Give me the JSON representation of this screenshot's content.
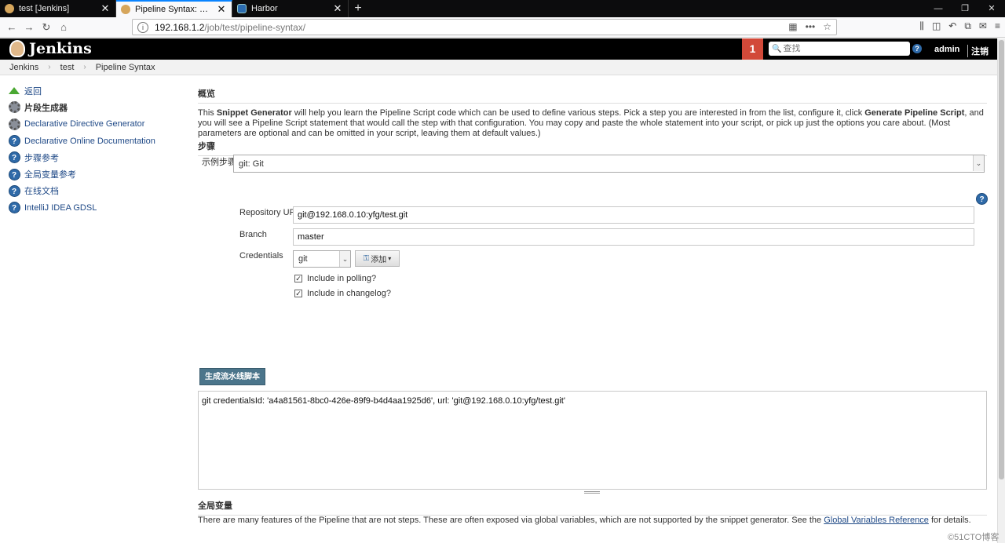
{
  "browser": {
    "tabs": [
      {
        "title": "test [Jenkins]",
        "active": false,
        "icon": "jenkins-favicon"
      },
      {
        "title": "Pipeline Syntax: Snippet Generator",
        "active": true,
        "icon": "jenkins-favicon"
      },
      {
        "title": "Harbor",
        "active": false,
        "icon": "harbor-favicon"
      }
    ],
    "url_host": "192.168.1.2",
    "url_path": "/job/test/pipeline-syntax/"
  },
  "header": {
    "logo_text": "Jenkins",
    "notification_count": "1",
    "search_placeholder": "查找",
    "user": "admin",
    "logout": "注销"
  },
  "breadcrumb": [
    "Jenkins",
    "test",
    "Pipeline Syntax"
  ],
  "sidebar": {
    "items": [
      {
        "label": "返回",
        "icon": "up-arrow-icon",
        "current": false
      },
      {
        "label": "片段生成器",
        "icon": "gear-icon",
        "current": true
      },
      {
        "label": "Declarative Directive Generator",
        "icon": "gear-icon",
        "current": false
      },
      {
        "label": "Declarative Online Documentation",
        "icon": "help-icon",
        "current": false
      },
      {
        "label": "步骤参考",
        "icon": "help-icon",
        "current": false
      },
      {
        "label": "全局变量参考",
        "icon": "help-icon",
        "current": false
      },
      {
        "label": "在线文档",
        "icon": "help-icon",
        "current": false
      },
      {
        "label": "IntelliJ IDEA GDSL",
        "icon": "help-icon",
        "current": false
      }
    ]
  },
  "main": {
    "overview_title": "概览",
    "intro_1": "This ",
    "intro_bold_1": "Snippet Generator",
    "intro_2": " will help you learn the Pipeline Script code which can be used to define various steps. Pick a step you are interested in from the list, configure it, click ",
    "intro_bold_2": "Generate Pipeline Script",
    "intro_3": ", and you will see a Pipeline Script statement that would call the step with that configuration. You may copy and paste the whole statement into your script, or pick up just the options you care about. (Most parameters are optional and can be omitted in your script, leaving them at default values.)",
    "steps_title": "步骤",
    "sample_step_label": "示例步骤",
    "sample_step_value": "git: Git",
    "repo_label": "Repository URL",
    "repo_value": "git@192.168.0.10:yfg/test.git",
    "branch_label": "Branch",
    "branch_value": "master",
    "credentials_label": "Credentials",
    "credentials_value": "git",
    "add_button": "添加",
    "polling_label": "Include in polling?",
    "polling_checked": true,
    "changelog_label": "Include in changelog?",
    "changelog_checked": true,
    "generate_button": "生成流水线脚本",
    "output": "git credentialsId: 'a4a81561-8bc0-426e-89f9-b4d4aa1925d6', url: 'git@192.168.0.10:yfg/test.git'",
    "global_title": "全局变量",
    "global_text_1": "There are many features of the Pipeline that are not steps. These are often exposed via global variables, which are not supported by the snippet generator. See the ",
    "global_link": "Global Variables Reference",
    "global_text_2": " for details."
  },
  "watermark": "©51CTO博客",
  "colors": {
    "header_bg": "#000000",
    "badge": "#d24939",
    "link": "#204a87",
    "generate_button": "#4b758b"
  }
}
